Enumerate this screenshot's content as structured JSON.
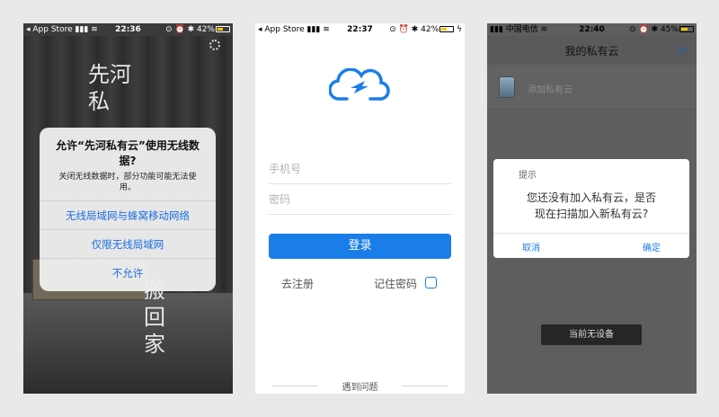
{
  "phone1": {
    "status": {
      "carrier": "App Store",
      "time": "22:36",
      "battery": "42%"
    },
    "vertical_text": [
      "先河",
      "私",
      "搬",
      "回",
      "家"
    ],
    "alert": {
      "title": "允许“先河私有云”使用无线数据?",
      "message": "关闭无线数据时，部分功能可能无法使用。",
      "buttons": [
        "无线局域网与蜂窝移动网络",
        "仅限无线局域网",
        "不允许"
      ]
    }
  },
  "phone2": {
    "status": {
      "carrier": "App Store",
      "time": "22:37",
      "battery": "42%"
    },
    "phone_placeholder": "手机号",
    "password_placeholder": "密码",
    "login_label": "登录",
    "register_label": "去注册",
    "remember_label": "记住密码",
    "help_label": "遇到问题"
  },
  "phone3": {
    "status": {
      "carrier": "中国电信",
      "time": "22:40",
      "battery": "45%"
    },
    "nav_title": "我的私有云",
    "add_label": "添加私有云",
    "dialog": {
      "title": "提示",
      "message_line1": "您还没有加入私有云，是否",
      "message_line2": "现在扫描加入新私有云?",
      "cancel": "取消",
      "ok": "确定"
    },
    "no_device": "当前无设备"
  },
  "colors": {
    "accent": "#1a7ee8",
    "ios_blue": "#1b6fe0"
  }
}
